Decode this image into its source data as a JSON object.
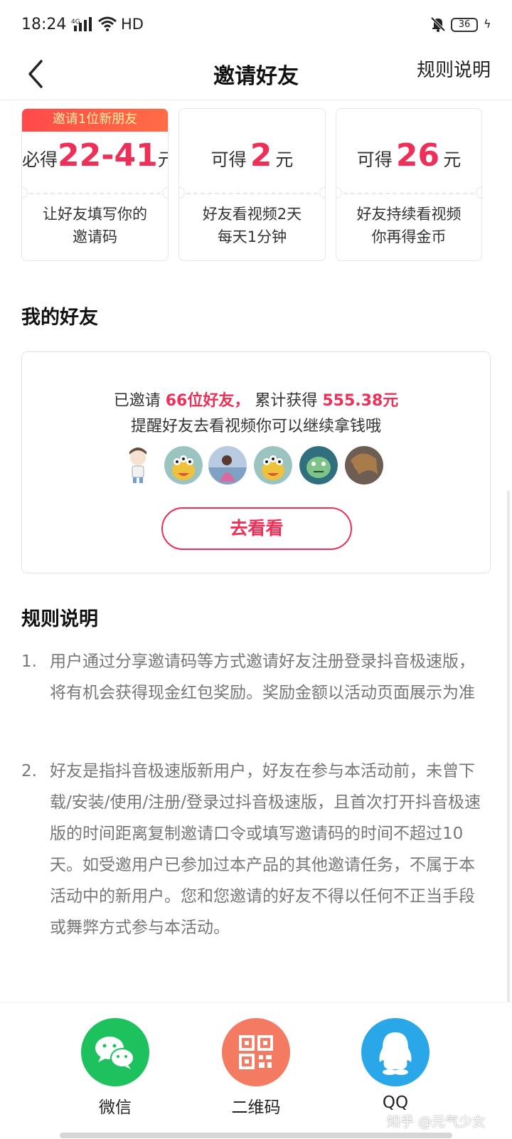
{
  "status_bar": {
    "time": "18:24",
    "network": "HD",
    "battery": "36"
  },
  "nav": {
    "title": "邀请好友",
    "rules_link": "规则说明"
  },
  "cards": [
    {
      "ribbon": "邀请1位新朋友",
      "prefix": "必得",
      "value": "22-41",
      "suffix": "元",
      "desc_line1": "让好友填写你的",
      "desc_line2": "邀请码"
    },
    {
      "prefix": "可得",
      "value": "2",
      "suffix": "元",
      "desc_line1": "好友看视频2天",
      "desc_line2": "每天1分钟"
    },
    {
      "prefix": "可得",
      "value": "26",
      "suffix": "元",
      "desc_line1": "好友持续看视频",
      "desc_line2": "你再得金币"
    }
  ],
  "friends": {
    "section_title": "我的好友",
    "invited_label": "已邀请",
    "invited_count": "66位好友，",
    "earned_label": "累计获得",
    "earned_amount": "555.38元",
    "reminder": "提醒好友去看视频你可以继续拿钱哦",
    "button": "去看看"
  },
  "rules": {
    "section_title": "规则说明",
    "items": [
      {
        "num": "1.",
        "text": "用户通过分享邀请码等方式邀请好友注册登录抖音极速版，将有机会获得现金红包奖励。奖励金额以活动页面展示为准"
      },
      {
        "num": "2.",
        "text": "好友是指抖音极速版新用户，好友在参与本活动前，未曾下载/安装/使用/注册/登录过抖音极速版，且首次打开抖音极速版的时间距离复制邀请口令或填写邀请码的时间不超过10天。如受邀用户已参加过本产品的其他邀请任务，不属于本活动中的新用户。您和您邀请的好友不得以任何不正当手段或舞弊方式参与本活动。"
      }
    ]
  },
  "share": {
    "items": [
      {
        "label": "微信",
        "icon": "wechat-icon",
        "color": "#1dc25e"
      },
      {
        "label": "二维码",
        "icon": "qrcode-icon",
        "color": "#f47a62"
      },
      {
        "label": "QQ",
        "icon": "qq-icon",
        "color": "#2aa7e8"
      }
    ]
  },
  "watermark": "知乎 @元气少女",
  "colors": {
    "accent": "#ee2f58",
    "ribbon": "#ff4a4a"
  }
}
